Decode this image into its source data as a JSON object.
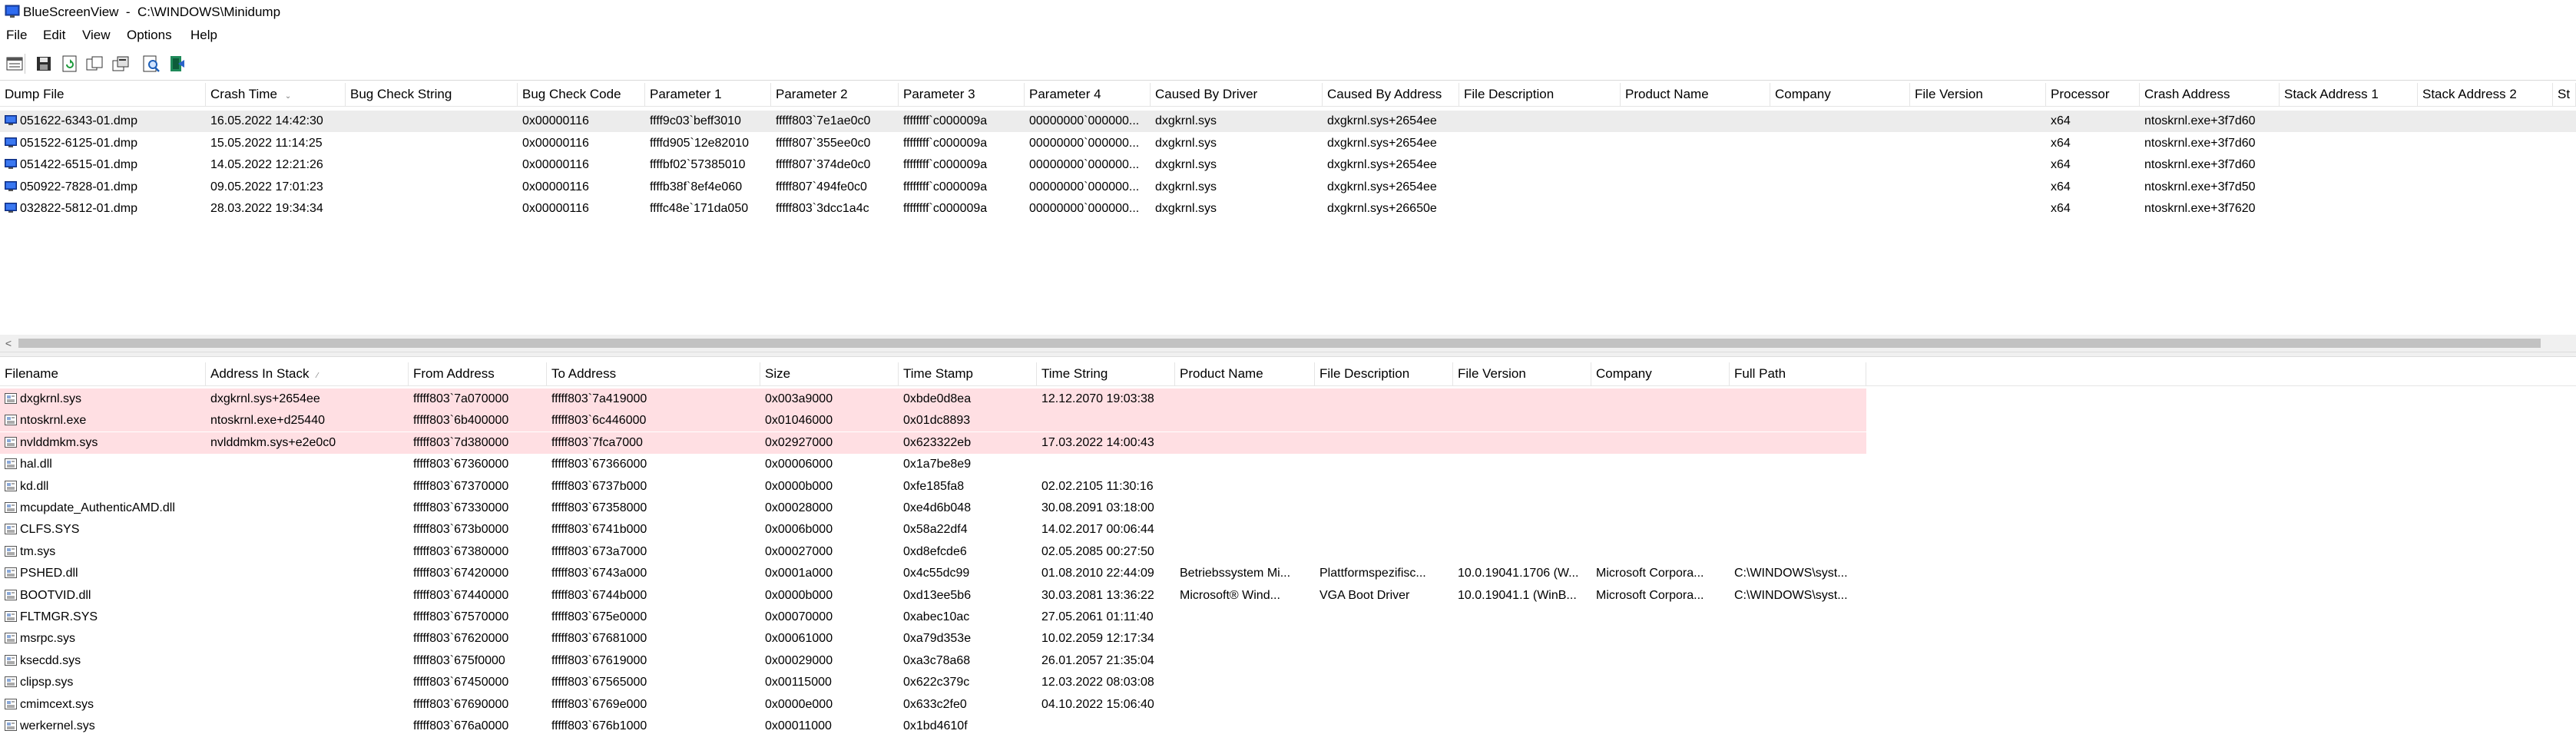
{
  "window": {
    "title": "BlueScreenView  -  C:\\WINDOWS\\Minidump"
  },
  "menu": [
    "File",
    "Edit",
    "View",
    "Options",
    "Help"
  ],
  "toolbar": [
    "properties-icon",
    "save-icon",
    "refresh-icon",
    "copy-icon",
    "advanced-options-icon",
    "find-icon",
    "exit-icon"
  ],
  "colors": {
    "highlight_row": "#ffdfe3",
    "selected_row": "#ececec"
  },
  "dumps": {
    "columns": [
      "Dump File",
      "Crash Time",
      "Bug Check String",
      "Bug Check Code",
      "Parameter 1",
      "Parameter 2",
      "Parameter 3",
      "Parameter 4",
      "Caused By Driver",
      "Caused By Address",
      "File Description",
      "Product Name",
      "Company",
      "File Version",
      "Processor",
      "Crash Address",
      "Stack Address 1",
      "Stack Address 2",
      "St"
    ],
    "sort_indicator": "⌄",
    "rows": [
      [
        "051622-6343-01.dmp",
        "16.05.2022 14:42:30",
        "",
        "0x00000116",
        "ffff9c03`beff3010",
        "fffff803`7e1ae0c0",
        "ffffffff`c000009a",
        "00000000`000000...",
        "dxgkrnl.sys",
        "dxgkrnl.sys+2654ee",
        "",
        "",
        "",
        "",
        "x64",
        "ntoskrnl.exe+3f7d60",
        "",
        "",
        ""
      ],
      [
        "051522-6125-01.dmp",
        "15.05.2022 11:14:25",
        "",
        "0x00000116",
        "ffffd905`12e82010",
        "fffff807`355ee0c0",
        "ffffffff`c000009a",
        "00000000`000000...",
        "dxgkrnl.sys",
        "dxgkrnl.sys+2654ee",
        "",
        "",
        "",
        "",
        "x64",
        "ntoskrnl.exe+3f7d60",
        "",
        "",
        ""
      ],
      [
        "051422-6515-01.dmp",
        "14.05.2022 12:21:26",
        "",
        "0x00000116",
        "ffffbf02`57385010",
        "fffff807`374de0c0",
        "ffffffff`c000009a",
        "00000000`000000...",
        "dxgkrnl.sys",
        "dxgkrnl.sys+2654ee",
        "",
        "",
        "",
        "",
        "x64",
        "ntoskrnl.exe+3f7d60",
        "",
        "",
        ""
      ],
      [
        "050922-7828-01.dmp",
        "09.05.2022 17:01:23",
        "",
        "0x00000116",
        "ffffb38f`8ef4e060",
        "fffff807`494fe0c0",
        "ffffffff`c000009a",
        "00000000`000000...",
        "dxgkrnl.sys",
        "dxgkrnl.sys+2654ee",
        "",
        "",
        "",
        "",
        "x64",
        "ntoskrnl.exe+3f7d50",
        "",
        "",
        ""
      ],
      [
        "032822-5812-01.dmp",
        "28.03.2022 19:34:34",
        "",
        "0x00000116",
        "ffffc48e`171da050",
        "fffff803`3dcc1a4c",
        "ffffffff`c000009a",
        "00000000`000000...",
        "dxgkrnl.sys",
        "dxgkrnl.sys+26650e",
        "",
        "",
        "",
        "",
        "x64",
        "ntoskrnl.exe+3f7620",
        "",
        "",
        ""
      ]
    ]
  },
  "modules": {
    "columns": [
      "Filename",
      "Address In Stack",
      "From Address",
      "To Address",
      "Size",
      "Time Stamp",
      "Time String",
      "Product Name",
      "File Description",
      "File Version",
      "Company",
      "Full Path"
    ],
    "sort_indicator": "⁄",
    "rows": [
      [
        "dxgkrnl.sys",
        "dxgkrnl.sys+2654ee",
        "fffff803`7a070000",
        "fffff803`7a419000",
        "0x003a9000",
        "0xbde0d8ea",
        "12.12.2070 19:03:38",
        "",
        "",
        "",
        "",
        ""
      ],
      [
        "ntoskrnl.exe",
        "ntoskrnl.exe+d25440",
        "fffff803`6b400000",
        "fffff803`6c446000",
        "0x01046000",
        "0x01dc8893",
        "",
        "",
        "",
        "",
        "",
        ""
      ],
      [
        "nvlddmkm.sys",
        "nvlddmkm.sys+e2e0c0",
        "fffff803`7d380000",
        "fffff803`7fca7000",
        "0x02927000",
        "0x623322eb",
        "17.03.2022 14:00:43",
        "",
        "",
        "",
        "",
        ""
      ],
      [
        "hal.dll",
        "",
        "fffff803`67360000",
        "fffff803`67366000",
        "0x00006000",
        "0x1a7be8e9",
        "",
        "",
        "",
        "",
        "",
        ""
      ],
      [
        "kd.dll",
        "",
        "fffff803`67370000",
        "fffff803`6737b000",
        "0x0000b000",
        "0xfe185fa8",
        "02.02.2105 11:30:16",
        "",
        "",
        "",
        "",
        ""
      ],
      [
        "mcupdate_AuthenticAMD.dll",
        "",
        "fffff803`67330000",
        "fffff803`67358000",
        "0x00028000",
        "0xe4d6b048",
        "30.08.2091 03:18:00",
        "",
        "",
        "",
        "",
        ""
      ],
      [
        "CLFS.SYS",
        "",
        "fffff803`673b0000",
        "fffff803`6741b000",
        "0x0006b000",
        "0x58a22df4",
        "14.02.2017 00:06:44",
        "",
        "",
        "",
        "",
        ""
      ],
      [
        "tm.sys",
        "",
        "fffff803`67380000",
        "fffff803`673a7000",
        "0x00027000",
        "0xd8efcde6",
        "02.05.2085 00:27:50",
        "",
        "",
        "",
        "",
        ""
      ],
      [
        "PSHED.dll",
        "",
        "fffff803`67420000",
        "fffff803`6743a000",
        "0x0001a000",
        "0x4c55dc99",
        "01.08.2010 22:44:09",
        "Betriebssystem Mi...",
        "Plattformspezifisc...",
        "10.0.19041.1706 (W...",
        "Microsoft Corpora...",
        "C:\\WINDOWS\\syst..."
      ],
      [
        "BOOTVID.dll",
        "",
        "fffff803`67440000",
        "fffff803`6744b000",
        "0x0000b000",
        "0xd13ee5b6",
        "30.03.2081 13:36:22",
        "Microsoft® Wind...",
        "VGA Boot Driver",
        "10.0.19041.1 (WinB...",
        "Microsoft Corpora...",
        "C:\\WINDOWS\\syst..."
      ],
      [
        "FLTMGR.SYS",
        "",
        "fffff803`67570000",
        "fffff803`675e0000",
        "0x00070000",
        "0xabec10ac",
        "27.05.2061 01:11:40",
        "",
        "",
        "",
        "",
        ""
      ],
      [
        "msrpc.sys",
        "",
        "fffff803`67620000",
        "fffff803`67681000",
        "0x00061000",
        "0xa79d353e",
        "10.02.2059 12:17:34",
        "",
        "",
        "",
        "",
        ""
      ],
      [
        "ksecdd.sys",
        "",
        "fffff803`675f0000",
        "fffff803`67619000",
        "0x00029000",
        "0xa3c78a68",
        "26.01.2057 21:35:04",
        "",
        "",
        "",
        "",
        ""
      ],
      [
        "clipsp.sys",
        "",
        "fffff803`67450000",
        "fffff803`67565000",
        "0x00115000",
        "0x622c379c",
        "12.03.2022 08:03:08",
        "",
        "",
        "",
        "",
        ""
      ],
      [
        "cmimcext.sys",
        "",
        "fffff803`67690000",
        "fffff803`6769e000",
        "0x0000e000",
        "0x633c2fe0",
        "04.10.2022 15:06:40",
        "",
        "",
        "",
        "",
        ""
      ],
      [
        "werkernel.sys",
        "",
        "fffff803`676a0000",
        "fffff803`676b1000",
        "0x00011000",
        "0x1bd4610f",
        "",
        "",
        "",
        "",
        "",
        ""
      ]
    ]
  }
}
